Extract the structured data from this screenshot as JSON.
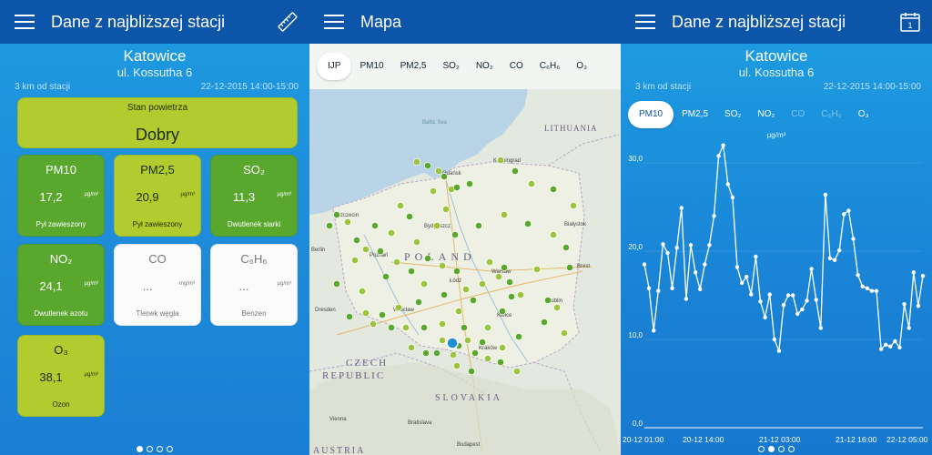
{
  "panel1": {
    "title": "Dane z najbliższej stacji",
    "city": "Katowice",
    "street": "ul. Kossutha 6",
    "distance": "3 km od stacji",
    "datetime": "22-12-2015 14:00-15:00",
    "quality": {
      "label": "Stan powietrza",
      "value": "Dobry"
    },
    "tiles": [
      {
        "name": "PM10",
        "value": "17,2",
        "unit": "µg/m³",
        "desc": "Pył zawieszony"
      },
      {
        "name": "PM2,5",
        "value": "20,9",
        "unit": "µg/m³",
        "desc": "Pył zawieszony"
      },
      {
        "name": "SO₂",
        "value": "11,3",
        "unit": "µg/m³",
        "desc": "Dwutlenek siarki"
      },
      {
        "name": "NO₂",
        "value": "24,1",
        "unit": "µg/m³",
        "desc": "Dwutlenek azotu"
      },
      {
        "name": "CO",
        "value": "...",
        "unit": "mg/m³",
        "desc": "Tlenek węgla"
      },
      {
        "name": "C₆H₆",
        "value": "...",
        "unit": "µg/m³",
        "desc": "Benzen"
      },
      {
        "name": "O₃",
        "value": "38,1",
        "unit": "µg/m³",
        "desc": "Ozon"
      }
    ]
  },
  "panel2": {
    "title": "Mapa",
    "tabs": [
      "IJP",
      "PM10",
      "PM2,5",
      "SO₂",
      "NO₂",
      "CO",
      "C₆H₆",
      "O₃"
    ],
    "labels": {
      "baltic": "Baltic Sea",
      "lithuania": "LITHUANIA",
      "poland": "POLAND",
      "czech1": "CZECH",
      "czech2": "REPUBLIC",
      "slovakia": "SLOVAKIA",
      "austria": "AUSTRIA",
      "cities": [
        "Gdańsk",
        "Kaliningrad",
        "Szczecin",
        "Bydgoszcz",
        "Białystok",
        "Poznań",
        "Warsaw",
        "Łódź",
        "Brest",
        "Dresden",
        "Wrocław",
        "Kielce",
        "Lublin",
        "Kraków",
        "Bratislava",
        "Budapest",
        "Vienna",
        "Berlin"
      ]
    }
  },
  "panel3": {
    "title": "Dane z najbliższej stacji",
    "calendar_day": "1",
    "city": "Katowice",
    "street": "ul. Kossutha 6",
    "distance": "3 km od stacji",
    "datetime": "22-12-2015 14:00-15:00",
    "tabs": [
      "PM10",
      "PM2,5",
      "SO₂",
      "NO₂",
      "CO",
      "C₆H₆",
      "O₃"
    ],
    "unit": "µg/m³"
  },
  "chart_data": {
    "type": "line",
    "title": "",
    "xlabel": "",
    "ylabel": "µg/m³",
    "ylim": [
      0,
      33
    ],
    "yticks": [
      "0,0",
      "10,0",
      "20,0",
      "30,0"
    ],
    "xticks": [
      "20-12 01:00",
      "20-12 14:00",
      "21-12 03:00",
      "21-12 16:00",
      "22-12 05:00"
    ],
    "series": [
      {
        "values": [
          18.5,
          15.8,
          11,
          15.5,
          20.8,
          19.8,
          15.8,
          20.4,
          24.9,
          14.6,
          20.7,
          17.6,
          15.7,
          18.5,
          20.7,
          24,
          30.8,
          32,
          27.6,
          26.1,
          18.2,
          16.4,
          17.1,
          15.1,
          19.4,
          14.3,
          12.5,
          15.1,
          10,
          8.7,
          13.9,
          15,
          15,
          12.9,
          13.4,
          14.4,
          18,
          14.5,
          11.3,
          26.4,
          19.2,
          19,
          20.1,
          24.2,
          24.6,
          21.4,
          17.3,
          16,
          15.8,
          15.5,
          15.5,
          8.9,
          9.4,
          9.2,
          9.8,
          9.1,
          14,
          11.3,
          17.6,
          13.8,
          17.2
        ]
      }
    ]
  }
}
